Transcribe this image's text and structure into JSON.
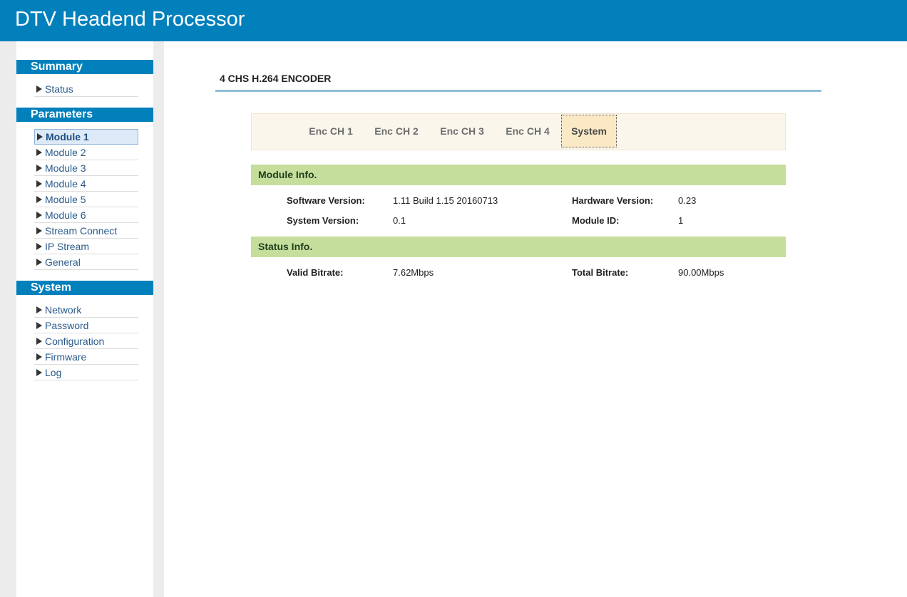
{
  "app_title": "DTV Headend Processor",
  "sidebar": {
    "summary": {
      "header": "Summary",
      "items": [
        {
          "label": "Status"
        }
      ]
    },
    "parameters": {
      "header": "Parameters",
      "items": [
        {
          "label": "Module 1"
        },
        {
          "label": "Module 2"
        },
        {
          "label": "Module 3"
        },
        {
          "label": "Module 4"
        },
        {
          "label": "Module 5"
        },
        {
          "label": "Module 6"
        },
        {
          "label": "Stream Connect"
        },
        {
          "label": "IP Stream"
        },
        {
          "label": "General"
        }
      ]
    },
    "system": {
      "header": "System",
      "items": [
        {
          "label": "Network"
        },
        {
          "label": "Password"
        },
        {
          "label": "Configuration"
        },
        {
          "label": "Firmware"
        },
        {
          "label": "Log"
        }
      ]
    }
  },
  "main": {
    "page_title": "4 CHS H.264 ENCODER",
    "tabs": [
      {
        "label": "Enc CH 1"
      },
      {
        "label": "Enc CH 2"
      },
      {
        "label": "Enc CH 3"
      },
      {
        "label": "Enc CH 4"
      },
      {
        "label": "System"
      }
    ],
    "active_tab": "System",
    "module_info": {
      "header": "Module Info.",
      "software_version_label": "Software Version:",
      "software_version": "1.11 Build 1.15 20160713",
      "hardware_version_label": "Hardware Version:",
      "hardware_version": "0.23",
      "system_version_label": "System Version:",
      "system_version": "0.1",
      "module_id_label": "Module ID:",
      "module_id": "1"
    },
    "status_info": {
      "header": "Status Info.",
      "valid_bitrate_label": "Valid Bitrate:",
      "valid_bitrate": "7.62Mbps",
      "total_bitrate_label": "Total Bitrate:",
      "total_bitrate": "90.00Mbps"
    }
  },
  "colors": {
    "header_blue": "#0180bc",
    "panel_green": "#c6de9c",
    "tabbar_bg": "#faf6ec",
    "active_tab_bg": "#fbe9c6",
    "title_rule": "#8fbfd6"
  }
}
